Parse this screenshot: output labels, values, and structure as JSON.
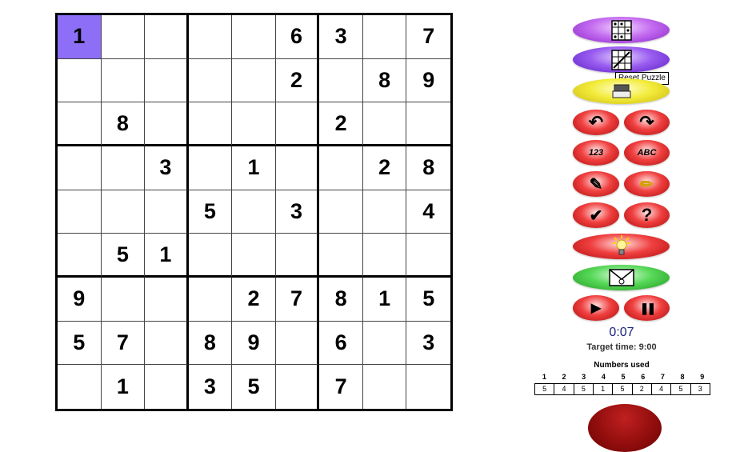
{
  "grid": {
    "selected_cell": "1-1",
    "rows": [
      [
        "1",
        "",
        "",
        "",
        "",
        "6",
        "3",
        "",
        "7"
      ],
      [
        "",
        "",
        "",
        "",
        "",
        "2",
        "",
        "8",
        "9"
      ],
      [
        "",
        "8",
        "",
        "",
        "",
        "",
        "2",
        "",
        ""
      ],
      [
        "",
        "",
        "3",
        "",
        "1",
        "",
        "",
        "2",
        "8"
      ],
      [
        "",
        "",
        "",
        "5",
        "",
        "3",
        "",
        "",
        "4"
      ],
      [
        "",
        "5",
        "1",
        "",
        "",
        "",
        "",
        "",
        ""
      ],
      [
        "9",
        "",
        "",
        "",
        "2",
        "7",
        "8",
        "1",
        "5"
      ],
      [
        "5",
        "7",
        "",
        "8",
        "9",
        "",
        "6",
        "",
        "3"
      ],
      [
        "",
        "1",
        "",
        "3",
        "5",
        "",
        "7",
        "",
        ""
      ]
    ]
  },
  "controls": {
    "tooltip": "Reset Puzzle",
    "mode_numbers_label": "123",
    "mode_letters_label": "ABC",
    "check_glyph": "✔",
    "help_glyph": "?",
    "undo_glyph": "↶",
    "redo_glyph": "↷",
    "play_glyph": "▶",
    "pause_glyph": "❚❚",
    "hint_glyph": "💡",
    "email_glyph": "✉",
    "pen_glyph": "✎",
    "pencil_glyph": "✏"
  },
  "timer": {
    "elapsed": "0:07",
    "target": "Target time: 9:00"
  },
  "numbers_used": {
    "title": "Numbers used",
    "digits": [
      "1",
      "2",
      "3",
      "4",
      "5",
      "6",
      "7",
      "8",
      "9"
    ],
    "counts": [
      "5",
      "4",
      "5",
      "1",
      "5",
      "2",
      "4",
      "5",
      "3"
    ]
  },
  "colors": {
    "selected_cell": "#8c6ef7",
    "timer_text": "#1a237e"
  }
}
